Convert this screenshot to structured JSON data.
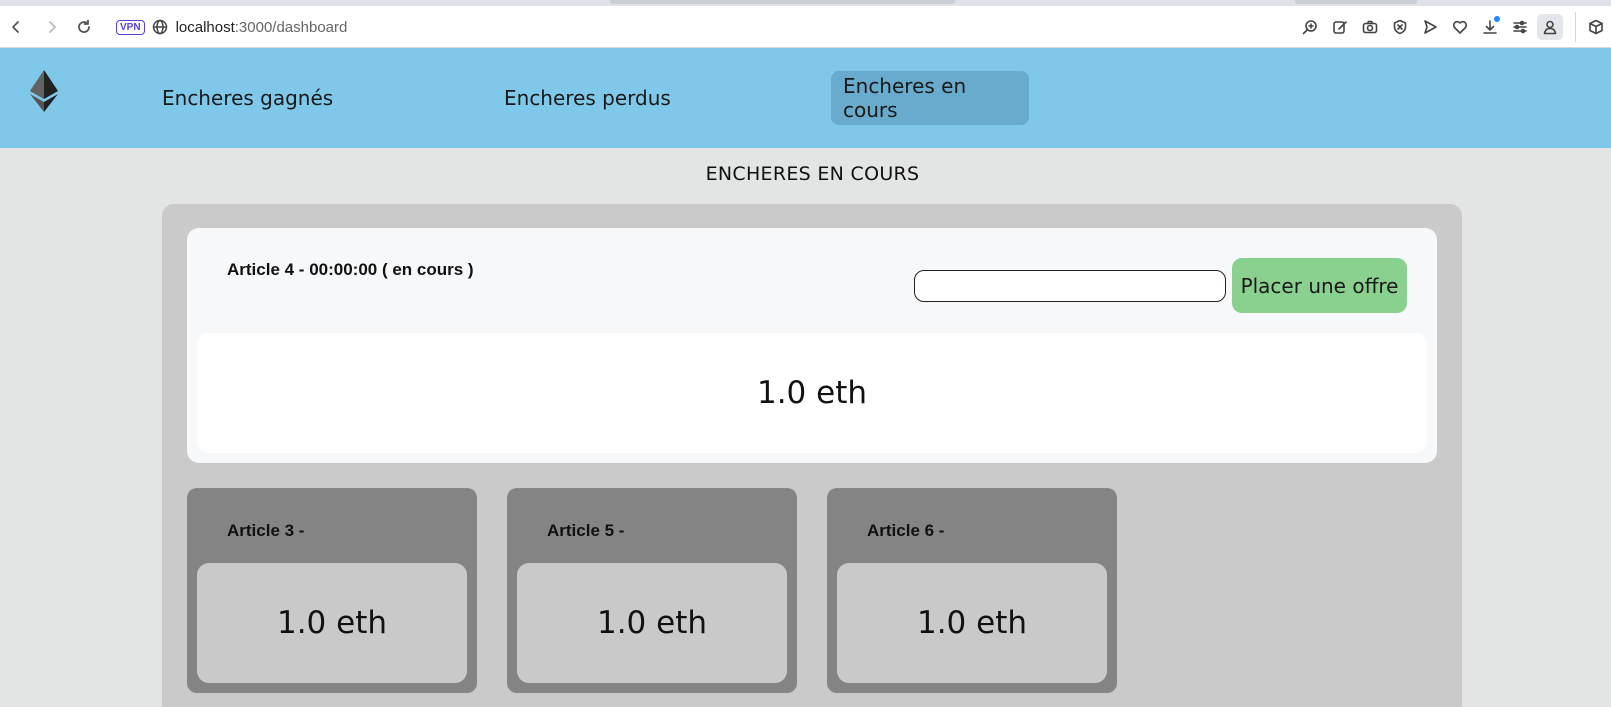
{
  "browser": {
    "vpn_badge": "VPN",
    "url_host": "localhost",
    "url_path": ":3000/dashboard"
  },
  "nav": {
    "items": [
      {
        "label": "Encheres gagnés",
        "active": false
      },
      {
        "label": "Encheres perdus",
        "active": false
      },
      {
        "label": "Encheres en cours",
        "active": true
      }
    ]
  },
  "page": {
    "title": "ENCHERES EN COURS"
  },
  "current_auction": {
    "title": "Article 4 - 00:00:00 ( en cours )",
    "bid_value": "",
    "bid_button_label": "Placer une offre",
    "price": "1.0 eth"
  },
  "articles": [
    {
      "title": "Article 3 -",
      "price": "1.0 eth"
    },
    {
      "title": "Article 5 -",
      "price": "1.0 eth"
    },
    {
      "title": "Article 6 -",
      "price": "1.0 eth"
    }
  ],
  "colors": {
    "nav_bg": "#7fc8ea",
    "nav_active": "#69abcc",
    "bid_button": "#8ad08e",
    "card_inactive": "#848484"
  }
}
